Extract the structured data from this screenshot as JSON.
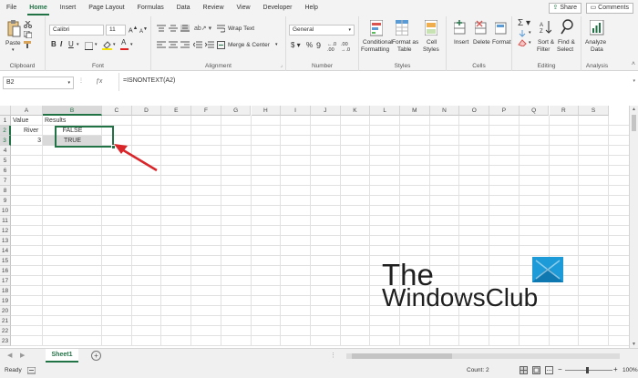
{
  "ribbon_tabs": [
    "File",
    "Home",
    "Insert",
    "Page Layout",
    "Formulas",
    "Data",
    "Review",
    "View",
    "Developer",
    "Help"
  ],
  "share_label": "Share",
  "comments_label": "Comments",
  "clipboard": {
    "paste": "Paste",
    "group": "Clipboard"
  },
  "font": {
    "name": "Calibri",
    "size": "11",
    "group": "Font"
  },
  "alignment": {
    "wrap": "Wrap Text",
    "merge": "Merge & Center",
    "group": "Alignment"
  },
  "number": {
    "format": "General",
    "group": "Number"
  },
  "styles": {
    "conditional": [
      "Conditional",
      "Formatting"
    ],
    "format_table": [
      "Format as",
      "Table"
    ],
    "cell_styles": [
      "Cell",
      "Styles"
    ],
    "group": "Styles"
  },
  "cells": {
    "insert": "Insert",
    "delete": "Delete",
    "format": "Format",
    "group": "Cells"
  },
  "editing": {
    "sort": [
      "Sort &",
      "Filter"
    ],
    "find": [
      "Find &",
      "Select"
    ],
    "group": "Editing"
  },
  "analysis": {
    "analyze": [
      "Analyze",
      "Data"
    ],
    "group": "Analysis"
  },
  "name_box": "B2",
  "formula": "=ISNONTEXT(A2)",
  "columns": [
    "A",
    "B",
    "C",
    "D",
    "E",
    "F",
    "G",
    "H",
    "I",
    "J",
    "K",
    "L",
    "M",
    "N",
    "O",
    "P",
    "Q",
    "R",
    "S"
  ],
  "rows": [
    "1",
    "2",
    "3",
    "4",
    "5",
    "6",
    "7",
    "8",
    "9",
    "10",
    "11",
    "12",
    "13",
    "14",
    "15",
    "16",
    "17",
    "18",
    "19",
    "20",
    "21",
    "22",
    "23"
  ],
  "cells_data": {
    "a1": "Value",
    "b1": "Results",
    "a2": "River",
    "b2": "FALSE",
    "a3": "3",
    "b3": "TRUE"
  },
  "sheet_tab": "Sheet1",
  "status": {
    "ready": "Ready",
    "count": "Count: 2",
    "zoom": "100%"
  },
  "watermark": {
    "line1": "The",
    "line2": "WindowsClub"
  },
  "accent_color": "#217346"
}
